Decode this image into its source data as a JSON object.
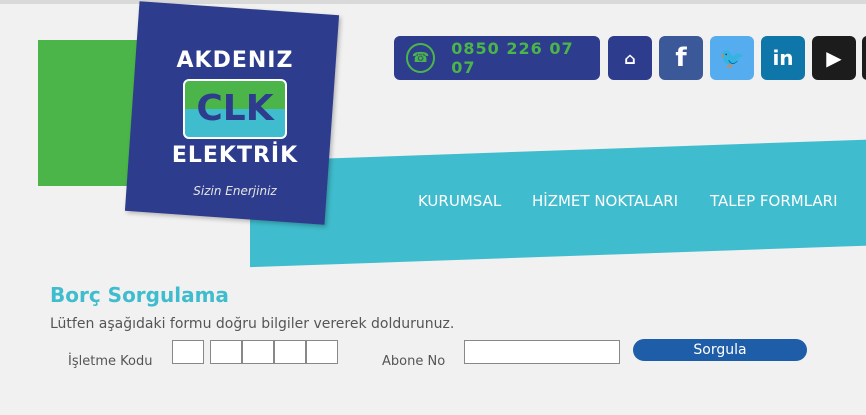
{
  "brand": {
    "top": "AKDENIZ",
    "mark": "CLK",
    "bottom": "ELEKTRİK",
    "slogan": "Sizin Enerjiniz"
  },
  "contact": {
    "phone": "0850 226 07 07",
    "icon": "phone-icon"
  },
  "social_icons": [
    "home-icon",
    "facebook-icon",
    "twitter-icon",
    "linkedin-icon",
    "google-play-icon"
  ],
  "nav": [
    "KURUMSAL",
    "HİZMET NOKTALARI",
    "TALEP FORMLARI"
  ],
  "form": {
    "title": "Borç Sorgulama",
    "description": "Lütfen aşağıdaki formu doğru bilgiler vererek doldurunuz.",
    "isletme_label": "İşletme Kodu",
    "abone_label": "Abone No",
    "submit": "Sorgula"
  },
  "colors": {
    "navy": "#2d3c8c",
    "green": "#4bb54a",
    "teal": "#3fbccd",
    "button": "#1e5da8"
  }
}
